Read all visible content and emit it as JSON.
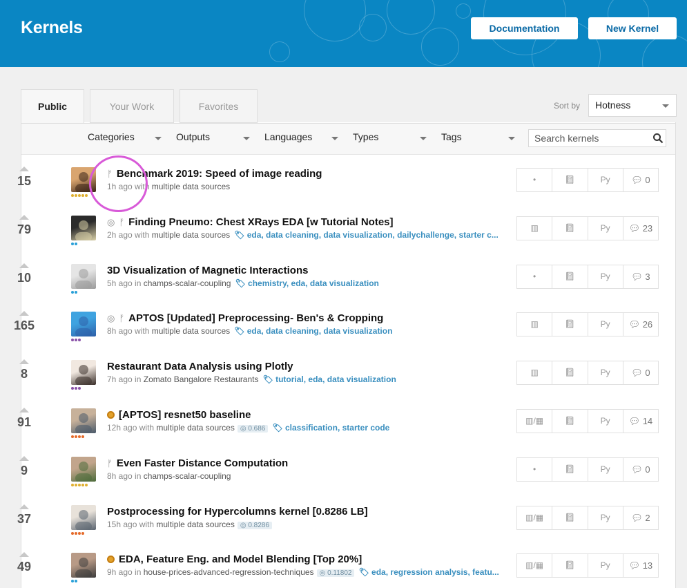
{
  "header": {
    "title": "Kernels",
    "documentation_label": "Documentation",
    "new_kernel_label": "New Kernel",
    "bg_color": "#0a86c3"
  },
  "tabs": [
    "Public",
    "Your Work",
    "Favorites"
  ],
  "sort": {
    "label": "Sort by",
    "value": "Hotness"
  },
  "filters": [
    "Categories",
    "Outputs",
    "Languages",
    "Types",
    "Tags"
  ],
  "search": {
    "placeholder": "Search kernels"
  },
  "kernels": [
    {
      "votes": "15",
      "title": "Benchmark 2019: Speed of image reading",
      "time": "1h ago",
      "conj": "with",
      "source": "multiple data sources",
      "score": "",
      "tags": "",
      "lang": "Py",
      "comments": "0"
    },
    {
      "votes": "79",
      "title": "Finding Pneumo: Chest XRays EDA [w Tutorial Notes]",
      "time": "2h ago",
      "conj": "with",
      "source": "multiple data sources",
      "score": "",
      "tags": "eda, data cleaning, data visualization, dailychallenge, starter c...",
      "lang": "Py",
      "comments": "23"
    },
    {
      "votes": "10",
      "title": "3D Visualization of Magnetic Interactions",
      "time": "5h ago",
      "conj": "in",
      "source": "champs-scalar-coupling",
      "score": "",
      "tags": "chemistry, eda, data visualization",
      "lang": "Py",
      "comments": "3"
    },
    {
      "votes": "165",
      "title": "APTOS [Updated] Preprocessing- Ben's & Cropping",
      "time": "8h ago",
      "conj": "with",
      "source": "multiple data sources",
      "score": "",
      "tags": "eda, data cleaning, data visualization",
      "lang": "Py",
      "comments": "26"
    },
    {
      "votes": "8",
      "title": "Restaurant Data Analysis using Plotly",
      "time": "7h ago",
      "conj": "in",
      "source": "Zomato Bangalore Restaurants",
      "score": "",
      "tags": "tutorial, eda, data visualization",
      "lang": "Py",
      "comments": "0"
    },
    {
      "votes": "91",
      "title": "[APTOS] resnet50 baseline",
      "time": "12h ago",
      "conj": "with",
      "source": "multiple data sources",
      "score": "0.686",
      "tags": "classification, starter code",
      "lang": "Py",
      "comments": "14"
    },
    {
      "votes": "9",
      "title": "Even Faster Distance Computation",
      "time": "8h ago",
      "conj": "in",
      "source": "champs-scalar-coupling",
      "score": "",
      "tags": "",
      "lang": "Py",
      "comments": "0"
    },
    {
      "votes": "37",
      "title": "Postprocessing for Hypercolumns kernel [0.8286 LB]",
      "time": "15h ago",
      "conj": "with",
      "source": "multiple data sources",
      "score": "0.8286",
      "tags": "",
      "lang": "Py",
      "comments": "2"
    },
    {
      "votes": "49",
      "title": "EDA, Feature Eng. and Model Blending [Top 20%]",
      "time": "9h ago",
      "conj": "in",
      "source": "house-prices-advanced-regression-techniques",
      "score": "0.11802",
      "tags": "eda, regression analysis, featu...",
      "lang": "Py",
      "comments": "13"
    }
  ]
}
